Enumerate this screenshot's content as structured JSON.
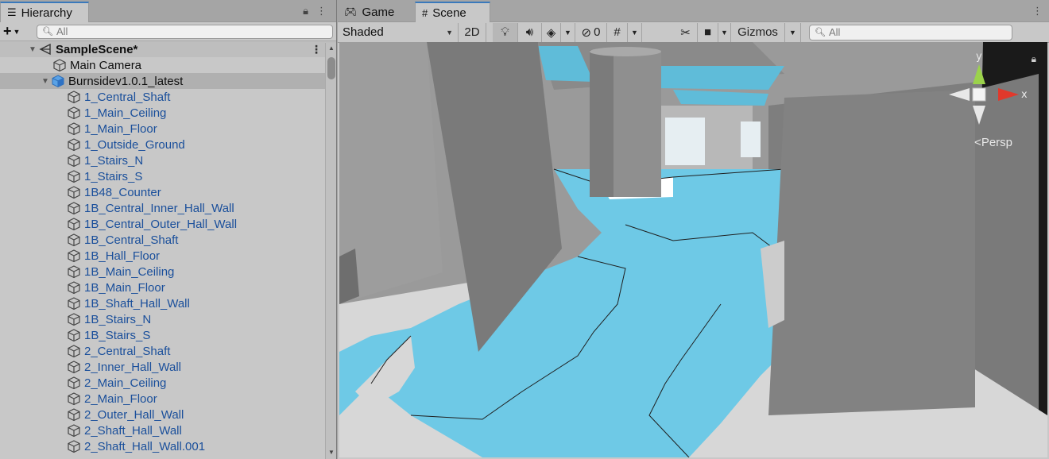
{
  "hierarchy": {
    "tab_label": "Hierarchy",
    "search_placeholder": "All",
    "scene_name": "SampleScene*",
    "root_items": [
      {
        "label": "Main Camera"
      },
      {
        "label": "Burnsidev1.0.1_latest"
      }
    ],
    "children": [
      "1_Central_Shaft",
      "1_Main_Ceiling",
      "1_Main_Floor",
      "1_Outside_Ground",
      "1_Stairs_N",
      "1_Stairs_S",
      "1B48_Counter",
      "1B_Central_Inner_Hall_Wall",
      "1B_Central_Outer_Hall_Wall",
      "1B_Central_Shaft",
      "1B_Hall_Floor",
      "1B_Main_Ceiling",
      "1B_Main_Floor",
      "1B_Shaft_Hall_Wall",
      "1B_Stairs_N",
      "1B_Stairs_S",
      "2_Central_Shaft",
      "2_Inner_Hall_Wall",
      "2_Main_Ceiling",
      "2_Main_Floor",
      "2_Outer_Hall_Wall",
      "2_Shaft_Hall_Wall",
      "2_Shaft_Hall_Wall.001"
    ]
  },
  "scene_tabs": {
    "game": "Game",
    "scene": "Scene"
  },
  "scene_toolbar": {
    "shading_mode": "Shaded",
    "toggle_2d": "2D",
    "hidden_count": "0",
    "gizmos": "Gizmos",
    "search_placeholder": "All"
  },
  "viewport": {
    "axis_y": "y",
    "axis_x": "x",
    "projection": "Persp"
  },
  "colors": {
    "accent_tab": "#3a79bb",
    "navmesh": "#6ec9e6",
    "wall": "#7d7d7d",
    "floor": "#d6d6d6",
    "hierarchy_child_text": "#1a4f9b"
  }
}
